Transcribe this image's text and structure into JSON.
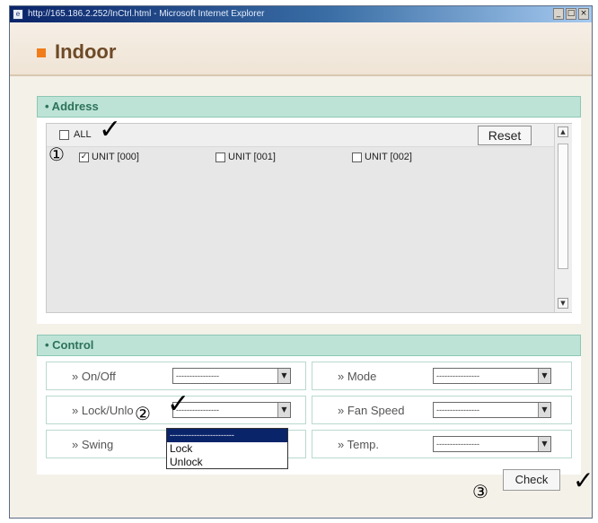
{
  "titlebar": {
    "text": "http://165.186.2.252/InCtrl.html - Microsoft Internet Explorer",
    "minimize": "_",
    "maximize": "□",
    "close": "×",
    "icon": "ie-icon"
  },
  "page": {
    "title": "Indoor"
  },
  "address": {
    "heading": "• Address",
    "all_label": "ALL",
    "all_checked": false,
    "reset_label": "Reset",
    "units": [
      {
        "label": "UNIT [000]",
        "checked": true
      },
      {
        "label": "UNIT [001]",
        "checked": false
      },
      {
        "label": "UNIT [002]",
        "checked": false
      }
    ]
  },
  "control": {
    "heading": "• Control",
    "rows": [
      {
        "left": {
          "label": "» On/Off",
          "value": "----------------"
        },
        "right": {
          "label": "» Mode",
          "value": "----------------"
        }
      },
      {
        "left": {
          "label": "» Lock/Unlo",
          "value": "----------------"
        },
        "right": {
          "label": "» Fan Speed",
          "value": "----------------"
        }
      },
      {
        "left": {
          "label": "» Swing",
          "value": ""
        },
        "right": {
          "label": "» Temp.",
          "value": "----------------"
        }
      }
    ],
    "lock_dropdown": [
      "------------------------",
      "Lock",
      "Unlock"
    ]
  },
  "check_label": "Check",
  "annotations": {
    "step1": "①",
    "step2": "②",
    "step3": "③",
    "checkmark": "✓"
  },
  "colors": {
    "accent": "#f07c1a",
    "title": "#6e4a26",
    "section_bg": "#bde3d7",
    "section_text": "#2d7259",
    "titlebar": "#0a246a"
  }
}
